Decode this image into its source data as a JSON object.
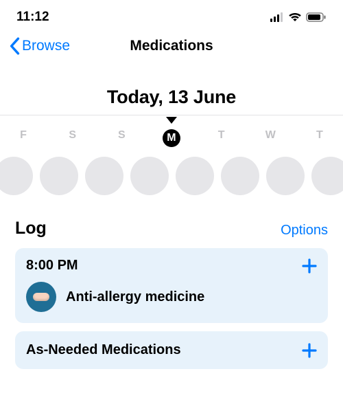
{
  "status": {
    "time": "11:12"
  },
  "nav": {
    "back": "Browse",
    "title": "Medications"
  },
  "date_label": "Today, 13 June",
  "week": {
    "days": [
      "F",
      "S",
      "S",
      "M",
      "T",
      "W",
      "T"
    ],
    "selected_index": 3
  },
  "log": {
    "title": "Log",
    "options": "Options",
    "card": {
      "time": "8:00 PM",
      "med_name": "Anti-allergy medicine"
    },
    "as_needed": "As-Needed Medications"
  },
  "colors": {
    "accent": "#007aff",
    "card_bg": "#e7f2fb",
    "med_icon_bg": "#1f6e95"
  }
}
